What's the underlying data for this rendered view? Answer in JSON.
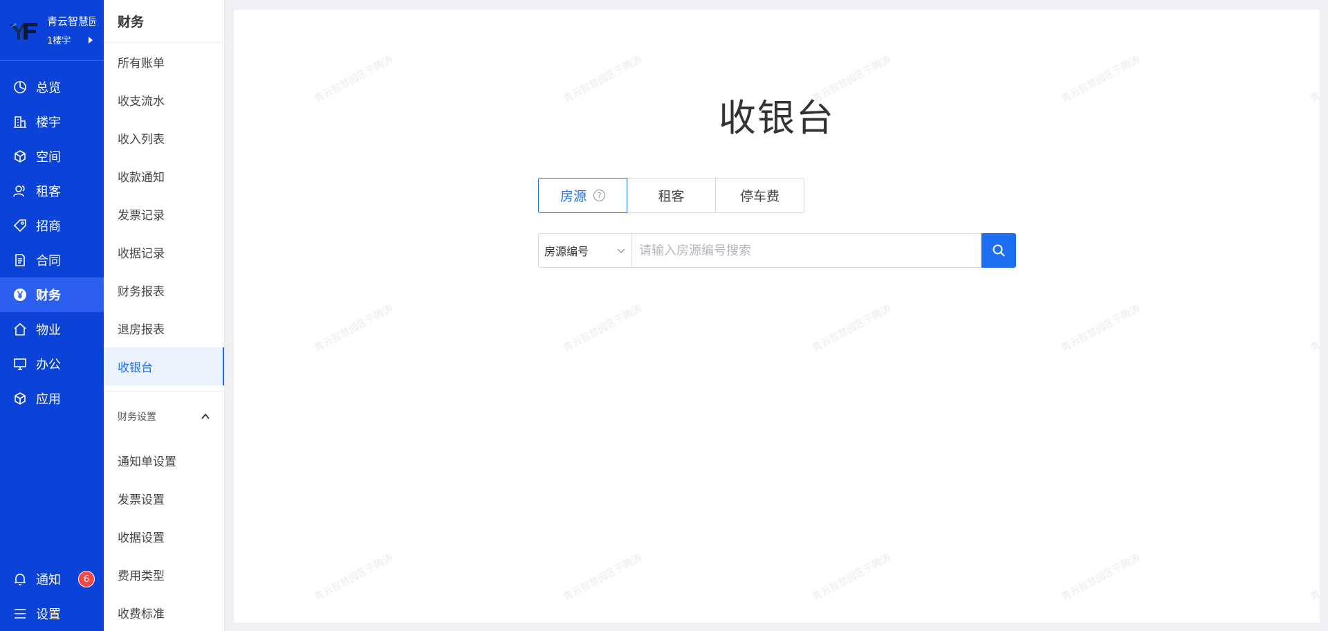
{
  "brand": {
    "name": "青云智慧园",
    "building": "1楼宇"
  },
  "rail": {
    "items": [
      {
        "label": "总览",
        "icon": "pie-chart-icon"
      },
      {
        "label": "楼宇",
        "icon": "building-icon"
      },
      {
        "label": "空间",
        "icon": "cube-icon"
      },
      {
        "label": "租客",
        "icon": "users-icon"
      },
      {
        "label": "招商",
        "icon": "tag-icon"
      },
      {
        "label": "合同",
        "icon": "document-icon"
      },
      {
        "label": "财务",
        "icon": "yen-coin-icon"
      },
      {
        "label": "物业",
        "icon": "home-icon"
      },
      {
        "label": "办公",
        "icon": "monitor-icon"
      },
      {
        "label": "应用",
        "icon": "box-icon"
      }
    ],
    "notify_label": "通知",
    "notify_count": "6",
    "settings_label": "设置"
  },
  "submenu": {
    "title": "财务",
    "items": [
      "所有账单",
      "收支流水",
      "收入列表",
      "收款通知",
      "发票记录",
      "收据记录",
      "财务报表",
      "退房报表",
      "收银台"
    ],
    "group_label": "财务设置",
    "group_items": [
      "通知单设置",
      "发票设置",
      "收据设置",
      "费用类型",
      "收费标准"
    ]
  },
  "main": {
    "title": "收银台",
    "tabs": [
      "房源",
      "租客",
      "停车费"
    ],
    "help_glyph": "?",
    "search_type": "房源编号",
    "search_placeholder": "请输入房源编号搜索"
  },
  "watermark": "青云智慧园区于腾涛",
  "colors": {
    "rail_bg": "#0b43d8",
    "rail_active": "#2c5ff0",
    "accent": "#1d6ff2",
    "badge": "#f5474a"
  }
}
